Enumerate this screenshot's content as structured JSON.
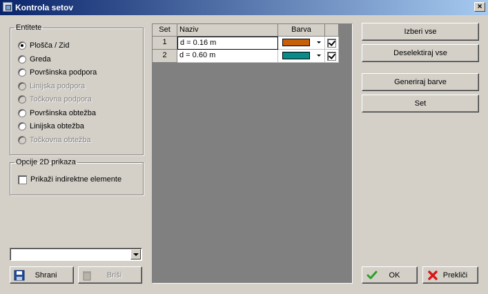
{
  "window": {
    "title": "Kontrola setov",
    "close_symbol": "×"
  },
  "entities": {
    "legend": "Entitete",
    "options": [
      {
        "label": "Plošča / Zid",
        "selected": true,
        "enabled": true
      },
      {
        "label": "Greda",
        "selected": false,
        "enabled": true
      },
      {
        "label": "Površinska podpora",
        "selected": false,
        "enabled": true
      },
      {
        "label": "Linijska podpora",
        "selected": false,
        "enabled": false
      },
      {
        "label": "Točkovna podpora",
        "selected": false,
        "enabled": false
      },
      {
        "label": "Površinska obtežba",
        "selected": false,
        "enabled": true
      },
      {
        "label": "Linijska obtežba",
        "selected": false,
        "enabled": true
      },
      {
        "label": "Točkovna obtežba",
        "selected": false,
        "enabled": false
      }
    ]
  },
  "view_options": {
    "legend": "Opcije 2D prikaza",
    "show_indirect_label": "Prikaži indirektne elemente",
    "show_indirect_checked": false
  },
  "set_combo": {
    "value": ""
  },
  "buttons": {
    "save": "Shrani",
    "delete": "Briši",
    "select_all": "Izberi vse",
    "deselect_all": "Deselektiraj vse",
    "generate_colors": "Generiraj barve",
    "set": "Set",
    "ok": "OK",
    "cancel": "Prekliči"
  },
  "table": {
    "headers": {
      "set": "Set",
      "name": "Naziv",
      "color": "Barva",
      "check": ""
    },
    "rows": [
      {
        "set": "1",
        "name": "d = 0.16 m",
        "color": "#c8600a",
        "checked": true
      },
      {
        "set": "2",
        "name": "d = 0.60 m",
        "color": "#0a8a88",
        "checked": true
      }
    ]
  },
  "colors": {
    "title_start": "#0a246a",
    "title_end": "#a6caf0",
    "face": "#d4d0c8"
  }
}
